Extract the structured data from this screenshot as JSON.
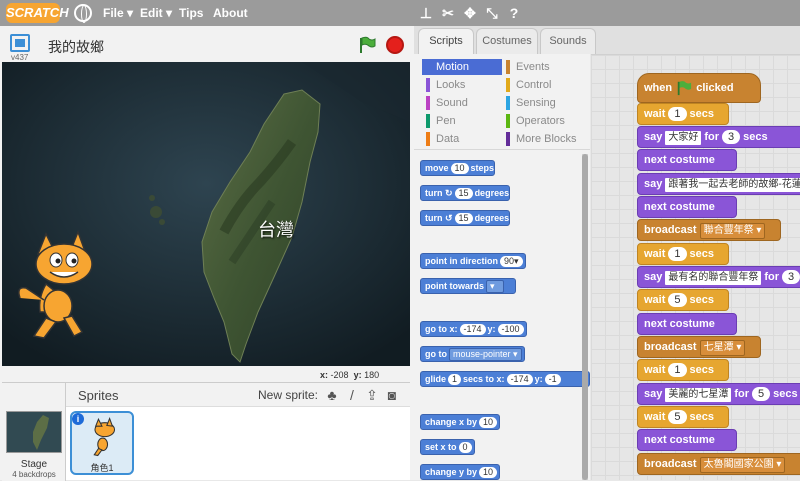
{
  "menu": {
    "logo": "SCRATCH",
    "file": "File ▾",
    "edit": "Edit ▾",
    "tips": "Tips",
    "about": "About"
  },
  "stage": {
    "version": "v437",
    "project_title": "我的故鄉",
    "map_label": "台灣",
    "x_label": "x:",
    "x_value": "-208",
    "y_label": "y:",
    "y_value": "180"
  },
  "sprites": {
    "title": "Sprites",
    "new_sprite": "New sprite:",
    "stage_label": "Stage",
    "backdrops": "4 backdrops",
    "sprite_name": "角色1"
  },
  "tabs": [
    "Scripts",
    "Costumes",
    "Sounds"
  ],
  "categories": {
    "left": [
      "Motion",
      "Looks",
      "Sound",
      "Pen",
      "Data"
    ],
    "right": [
      "Events",
      "Control",
      "Sensing",
      "Operators",
      "More Blocks"
    ],
    "colors": [
      "#4a6cd4",
      "#8a55d7",
      "#bb42c3",
      "#0e9a6c",
      "#ee7d16",
      "#c88330",
      "#e1a91a",
      "#2ca5e2",
      "#5cb712",
      "#632d99"
    ]
  },
  "palette_blocks": {
    "move": {
      "a": "move",
      "v": "10",
      "b": "steps"
    },
    "turn_right": {
      "a": "turn",
      "v": "15",
      "b": "degrees"
    },
    "turn_left": {
      "a": "turn",
      "v": "15",
      "b": "degrees"
    },
    "point_direction": {
      "a": "point in direction",
      "v": "90▾"
    },
    "point_towards": {
      "a": "point towards",
      "v": "▾"
    },
    "goto_xy": {
      "a": "go to x:",
      "x": "-174",
      "b": "y:",
      "y": "-100"
    },
    "goto": {
      "a": "go to",
      "v": "mouse-pointer ▾"
    },
    "glide": {
      "a": "glide",
      "v": "1",
      "b": "secs to x:",
      "x": "-174",
      "c": "y:",
      "y": "-1"
    },
    "change_x": {
      "a": "change x by",
      "v": "10"
    },
    "set_x": {
      "a": "set x to",
      "v": "0"
    },
    "change_y": {
      "a": "change y by",
      "v": "10"
    }
  },
  "script": {
    "hat": {
      "a": "when",
      "b": "clicked"
    },
    "b1": {
      "a": "wait",
      "v": "1",
      "b": "secs"
    },
    "b2": {
      "a": "say",
      "t": "大家好",
      "b": "for",
      "v": "3",
      "c": "secs"
    },
    "b3": {
      "a": "next costume"
    },
    "b4": {
      "a": "say",
      "t": "跟著我一起去老師的故鄉-花蓮"
    },
    "b5": {
      "a": "next costume"
    },
    "b6": {
      "a": "broadcast",
      "v": "聯合豐年祭 ▾"
    },
    "b7": {
      "a": "wait",
      "v": "1",
      "b": "secs"
    },
    "b8": {
      "a": "say",
      "t": "最有名的聯合豐年祭",
      "b": "for",
      "v": "3"
    },
    "b9": {
      "a": "wait",
      "v": "5",
      "b": "secs"
    },
    "b10": {
      "a": "next costume"
    },
    "b11": {
      "a": "broadcast",
      "v": "七星潭 ▾"
    },
    "b12": {
      "a": "wait",
      "v": "1",
      "b": "secs"
    },
    "b13": {
      "a": "say",
      "t": "美麗的七星潭",
      "b": "for",
      "v": "5",
      "c": "secs"
    },
    "b14": {
      "a": "wait",
      "v": "5",
      "b": "secs"
    },
    "b15": {
      "a": "next costume"
    },
    "b16": {
      "a": "broadcast",
      "v": "太魯閣國家公園 ▾"
    }
  }
}
